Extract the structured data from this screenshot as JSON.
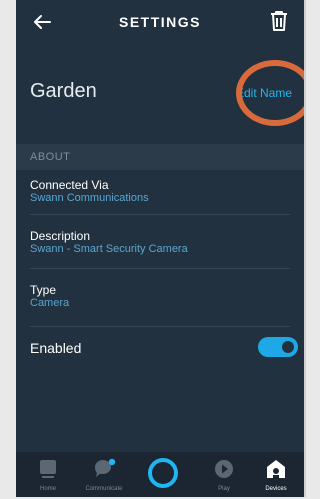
{
  "header": {
    "title": "SETTINGS",
    "back_icon": "back-arrow-icon",
    "delete_icon": "trash-icon"
  },
  "device": {
    "name": "Garden",
    "edit_label": "Edit Name"
  },
  "about": {
    "section_title": "ABOUT",
    "fields": [
      {
        "label": "Connected Via",
        "value": "Swann Communications"
      },
      {
        "label": "Description",
        "value": "Swann - Smart Security Camera"
      },
      {
        "label": "Type",
        "value": "Camera"
      }
    ]
  },
  "enabled": {
    "label": "Enabled",
    "state": true
  },
  "nav": {
    "items": [
      {
        "label": "Home",
        "icon": "home-icon"
      },
      {
        "label": "Communicate",
        "icon": "chat-bubble-icon"
      },
      {
        "label": "",
        "icon": "alexa-ring-icon"
      },
      {
        "label": "Play",
        "icon": "play-icon"
      },
      {
        "label": "Devices",
        "icon": "devices-house-icon"
      }
    ],
    "active": "Devices"
  },
  "colors": {
    "background": "#22313f",
    "accent": "#1fa8e6",
    "highlight": "#d96a3c"
  }
}
